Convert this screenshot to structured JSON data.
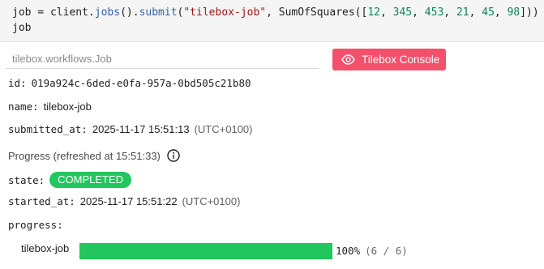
{
  "code_cell": {
    "line1": {
      "var": "job",
      "eq": " = ",
      "obj": "client.",
      "fn1": "jobs",
      "p1": "().",
      "fn2": "submit",
      "p2": "(",
      "str": "\"tilebox-job\"",
      "p3": ", SumOfSquares([",
      "n1": "12",
      "c1": ", ",
      "n2": "345",
      "c2": ", ",
      "n3": "453",
      "c3": ", ",
      "n4": "21",
      "c4": ", ",
      "n5": "45",
      "c5": ", ",
      "n6": "98",
      "p4": "]))"
    },
    "line2": "job"
  },
  "job": {
    "type_label": "tilebox.workflows.Job",
    "console_button": "Tilebox Console",
    "id_key": "id:",
    "id_value": "019a924c-6ded-e0fa-957a-0bd505c21b80",
    "name_key": "name:",
    "name_value": "tilebox-job",
    "submitted_key": "submitted_at:",
    "submitted_value": "2025-11-17 15:51:13",
    "submitted_tz": "(UTC+0100)",
    "progress_title": "Progress (refreshed at 15:51:33)",
    "state_key": "state:",
    "state_value": "COMPLETED",
    "started_key": "started_at:",
    "started_value": "2025-11-17 15:51:22",
    "started_tz": "(UTC+0100)",
    "progress_key": "progress:",
    "task_label": "tilebox-job",
    "progress_percent": "100%",
    "progress_count": "(6 / 6)",
    "progress_fraction": 1.0
  },
  "colors": {
    "accent": "#f4506b",
    "success": "#22c55e"
  },
  "icons": {
    "console": "eye-icon",
    "info": "info-icon"
  }
}
